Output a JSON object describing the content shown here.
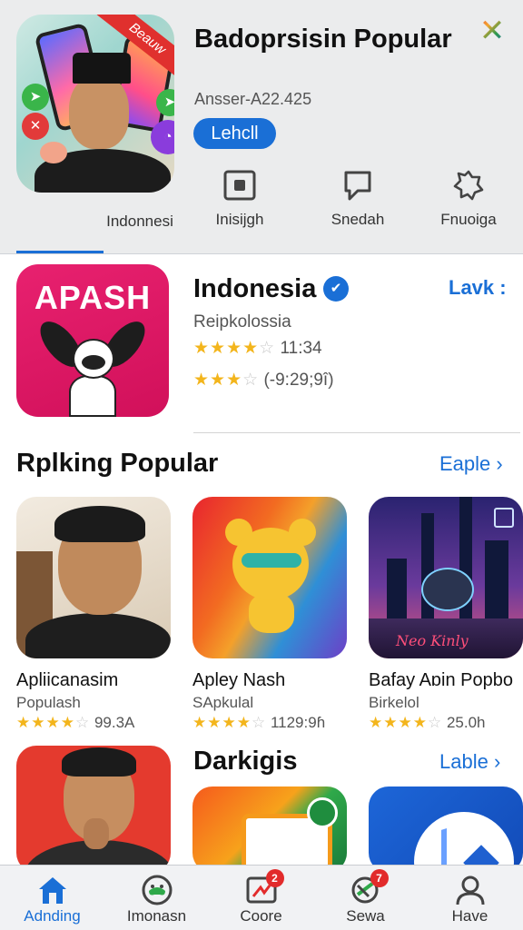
{
  "header": {
    "title": "Badoprsisin Popular",
    "subtitle": "Ansser-A22.425",
    "get_label": "Lehcll",
    "tabs": [
      {
        "label": "Indonnesi",
        "icon": "none"
      },
      {
        "label": "Inisijgh",
        "icon": "camera-icon"
      },
      {
        "label": "Snedah",
        "icon": "speech-bubble-icon"
      },
      {
        "label": "Fnuoiga",
        "icon": "badge-icon"
      }
    ],
    "hero_ribbon": "Beauw"
  },
  "featured": {
    "icon_text": "APASH",
    "title": "Indonesia",
    "subtitle": "Reipkolossia",
    "link": "Lavk :",
    "rating1_stars": 4,
    "rating1_text": "11:34",
    "rating2_stars": 3,
    "rating2_text": "(-9:29;9î)"
  },
  "popular": {
    "title": "Rplking Popular",
    "link": "Eaple ›",
    "cards": [
      {
        "name": "Apliicanasim",
        "category": "Populash",
        "stars": 4,
        "rating": "99.3A"
      },
      {
        "name": "Apley Nash",
        "category": "SApkulal",
        "stars": 4,
        "rating": "1129:9ɦ"
      },
      {
        "name": "Bafay Aɒin Popbo",
        "category": "Birkelol",
        "stars": 4,
        "rating": "25.0h",
        "image_text": "Neo Kinly"
      }
    ]
  },
  "darkigis": {
    "title": "Darkigis",
    "link": "Lable ›"
  },
  "tabbar": {
    "items": [
      {
        "label": "Adnding",
        "icon": "home-icon",
        "badge": ""
      },
      {
        "label": "Imonasn",
        "icon": "game-controller-icon",
        "badge": ""
      },
      {
        "label": "Coore",
        "icon": "apps-icon",
        "badge": "2"
      },
      {
        "label": "Sewa",
        "icon": "search-icon",
        "badge": "7"
      },
      {
        "label": "Have",
        "icon": "profile-icon",
        "badge": ""
      }
    ]
  },
  "colors": {
    "accent": "#1a6fd6",
    "star": "#f3b51c",
    "badge": "#e22b2b"
  }
}
